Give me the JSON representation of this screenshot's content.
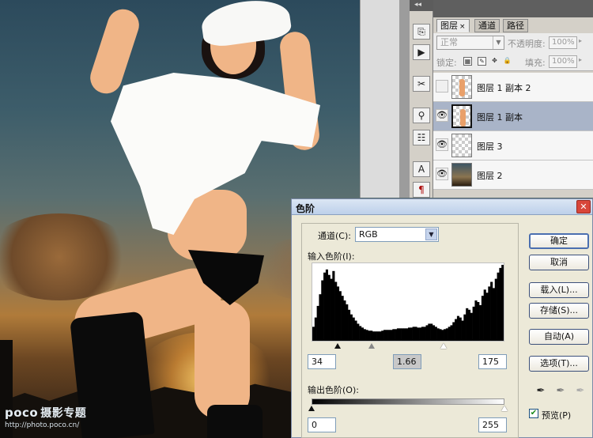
{
  "canvas": {
    "watermark_brand": "poco",
    "watermark_cn": "摄影专题",
    "watermark_url": "http://photo.poco.cn/"
  },
  "tools": {
    "buttons": [
      "history-tool",
      "actions-tool",
      "tool-presets",
      "clone-source",
      "layer-comps",
      "character",
      "paragraph"
    ]
  },
  "layers_panel": {
    "tabs": [
      {
        "label": "图层",
        "active": true
      },
      {
        "label": "通道",
        "active": false
      },
      {
        "label": "路径",
        "active": false
      }
    ],
    "blend_mode": "正常",
    "opacity_label": "不透明度:",
    "opacity_value": "100%",
    "lock_label": "锁定:",
    "fill_label": "填充:",
    "fill_value": "100%",
    "layers": [
      {
        "name": "图层 1 副本 2",
        "visible": false,
        "selected": false,
        "thumb": "figure"
      },
      {
        "name": "图层 1 副本",
        "visible": true,
        "selected": true,
        "thumb": "figure"
      },
      {
        "name": "图层 3",
        "visible": true,
        "selected": false,
        "thumb": "transparent"
      },
      {
        "name": "图层 2",
        "visible": true,
        "selected": false,
        "thumb": "photo"
      }
    ]
  },
  "levels_dialog": {
    "title": "色阶",
    "close": "✕",
    "channel_label": "通道(C):",
    "channel_value": "RGB",
    "input_label": "输入色阶(I):",
    "input_black": "34",
    "input_gamma": "1.66",
    "input_white": "175",
    "output_label": "输出色阶(O):",
    "output_black": "0",
    "output_white": "255",
    "buttons": {
      "ok": "确定",
      "cancel": "取消",
      "load": "载入(L)...",
      "save": "存储(S)...",
      "auto": "自动(A)",
      "options": "选项(T)..."
    },
    "preview_label": "预览(P)",
    "preview_checked": true,
    "slider_levels": {
      "black": 34,
      "gamma": 1.66,
      "white": 175
    },
    "histogram_bins": [
      18,
      30,
      45,
      60,
      78,
      88,
      92,
      85,
      80,
      90,
      76,
      70,
      64,
      58,
      52,
      47,
      40,
      34,
      30,
      26,
      22,
      19,
      17,
      15,
      14,
      13,
      13,
      12,
      12,
      12,
      12,
      13,
      14,
      14,
      14,
      14,
      15,
      15,
      16,
      16,
      16,
      16,
      16,
      17,
      17,
      18,
      18,
      17,
      17,
      18,
      18,
      20,
      22,
      22,
      20,
      18,
      16,
      15,
      14,
      15,
      16,
      18,
      20,
      24,
      28,
      32,
      30,
      26,
      34,
      42,
      40,
      36,
      44,
      52,
      50,
      46,
      58,
      66,
      62,
      70,
      76,
      68,
      80,
      88,
      94,
      98
    ],
    "colors": {
      "histogram": "#000000",
      "title_bar": "#bdd0ea",
      "dialog_bg": "#ece9d8"
    }
  }
}
